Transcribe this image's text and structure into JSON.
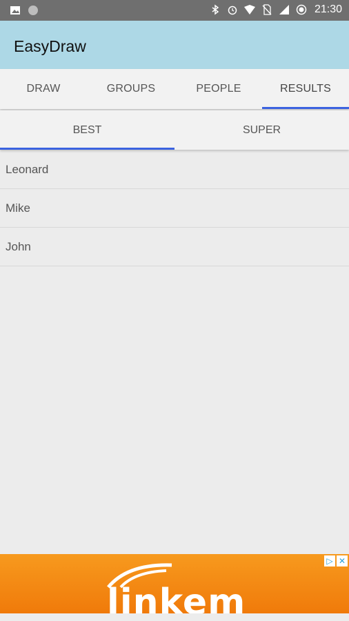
{
  "status_bar": {
    "time": "21:30",
    "left_icons": [
      "image-icon",
      "circle-icon"
    ],
    "right_icons": [
      "bluetooth-icon",
      "alarm-icon",
      "wifi-icon",
      "no-sim-icon",
      "signal-icon",
      "record-icon"
    ]
  },
  "app_bar": {
    "title": "EasyDraw",
    "color": "#add8e6"
  },
  "main_tabs": [
    {
      "label": "DRAW"
    },
    {
      "label": "GROUPS"
    },
    {
      "label": "PEOPLE"
    },
    {
      "label": "RESULTS",
      "active": true
    }
  ],
  "sub_tabs": [
    {
      "label": "BEST",
      "active": true
    },
    {
      "label": "SUPER"
    }
  ],
  "indicator_color": "#3b62e0",
  "list": [
    {
      "name": "Leonard"
    },
    {
      "name": "Mike"
    },
    {
      "name": "John"
    }
  ],
  "ad": {
    "brand": "linkem",
    "background": "#f28a14",
    "badge_icons": [
      "adchoices-icon",
      "close-icon"
    ]
  }
}
